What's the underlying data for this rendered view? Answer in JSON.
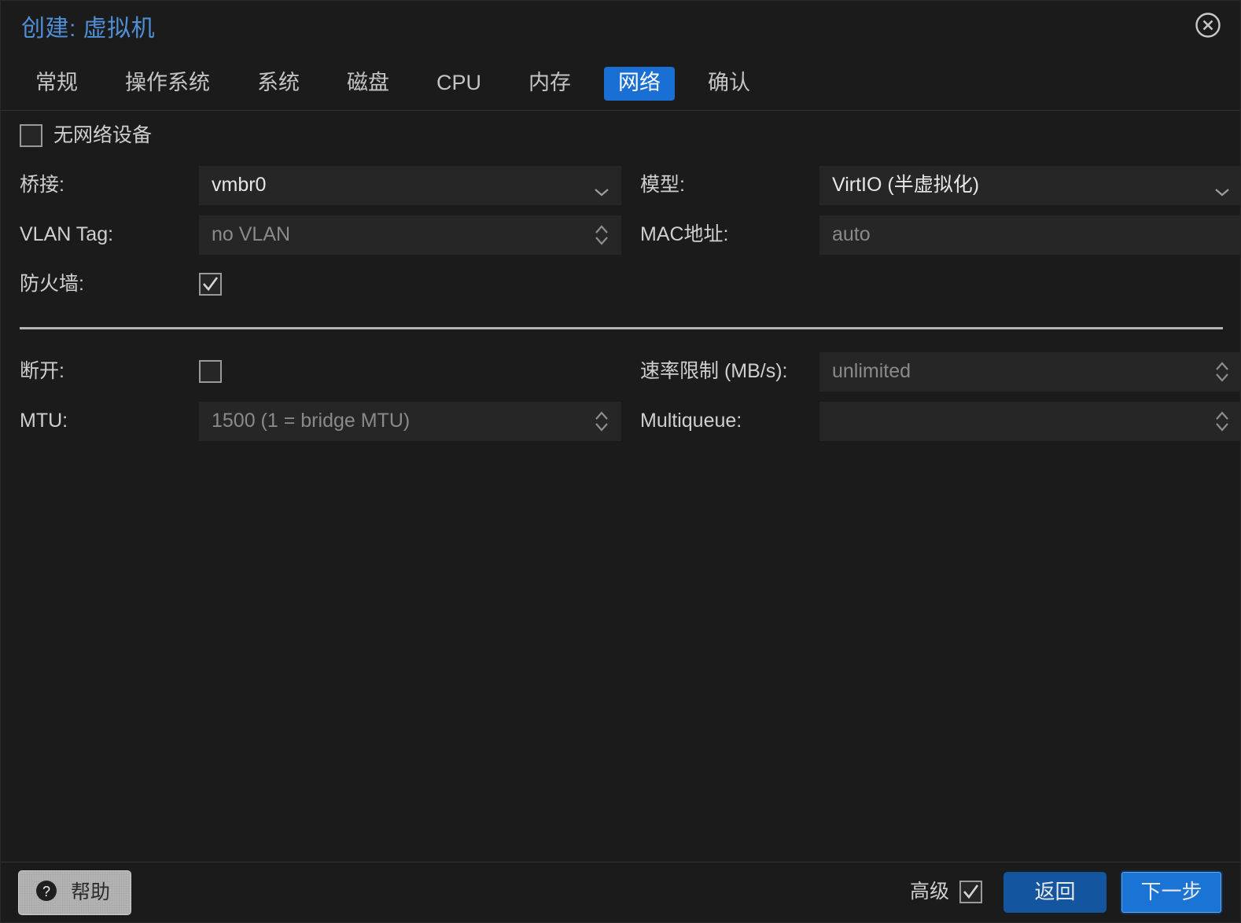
{
  "window": {
    "title": "创建: 虚拟机",
    "close_icon": "close-circle-icon"
  },
  "tabs": [
    {
      "label": "常规",
      "active": false
    },
    {
      "label": "操作系统",
      "active": false
    },
    {
      "label": "系统",
      "active": false
    },
    {
      "label": "磁盘",
      "active": false
    },
    {
      "label": "CPU",
      "active": false
    },
    {
      "label": "内存",
      "active": false
    },
    {
      "label": "网络",
      "active": true
    },
    {
      "label": "确认",
      "active": false
    }
  ],
  "form": {
    "no_network_device": {
      "label": "无网络设备",
      "checked": false
    },
    "bridge": {
      "label": "桥接:",
      "value": "vmbr0",
      "icon": "chevron-down-icon"
    },
    "model": {
      "label": "模型:",
      "value": "VirtIO (半虚拟化)",
      "icon": "chevron-down-icon"
    },
    "vlan_tag": {
      "label": "VLAN Tag:",
      "value": "",
      "placeholder": "no VLAN",
      "icon": "spinner-arrows-icon"
    },
    "mac_address": {
      "label": "MAC地址:",
      "value": "",
      "placeholder": "auto"
    },
    "firewall": {
      "label": "防火墙:",
      "checked": true
    },
    "disconnect": {
      "label": "断开:",
      "checked": false
    },
    "rate_limit": {
      "label": "速率限制 (MB/s):",
      "value": "",
      "placeholder": "unlimited",
      "icon": "spinner-arrows-icon"
    },
    "mtu": {
      "label": "MTU:",
      "value": "",
      "placeholder": "1500 (1 = bridge MTU)",
      "icon": "spinner-arrows-icon"
    },
    "multiqueue": {
      "label": "Multiqueue:",
      "value": "",
      "placeholder": "",
      "icon": "spinner-arrows-icon"
    }
  },
  "footer": {
    "help_label": "帮助",
    "help_icon": "question-mark-circle-icon",
    "advanced_label": "高级",
    "advanced_checked": true,
    "back_label": "返回",
    "next_label": "下一步"
  },
  "colors": {
    "accent": "#1a6fd4",
    "title": "#4f8fd6",
    "background": "#1b1b1b",
    "field_background": "#262626",
    "divider": "#b5b5b5",
    "next_button": "#1a74d6",
    "back_button": "#14559f"
  }
}
